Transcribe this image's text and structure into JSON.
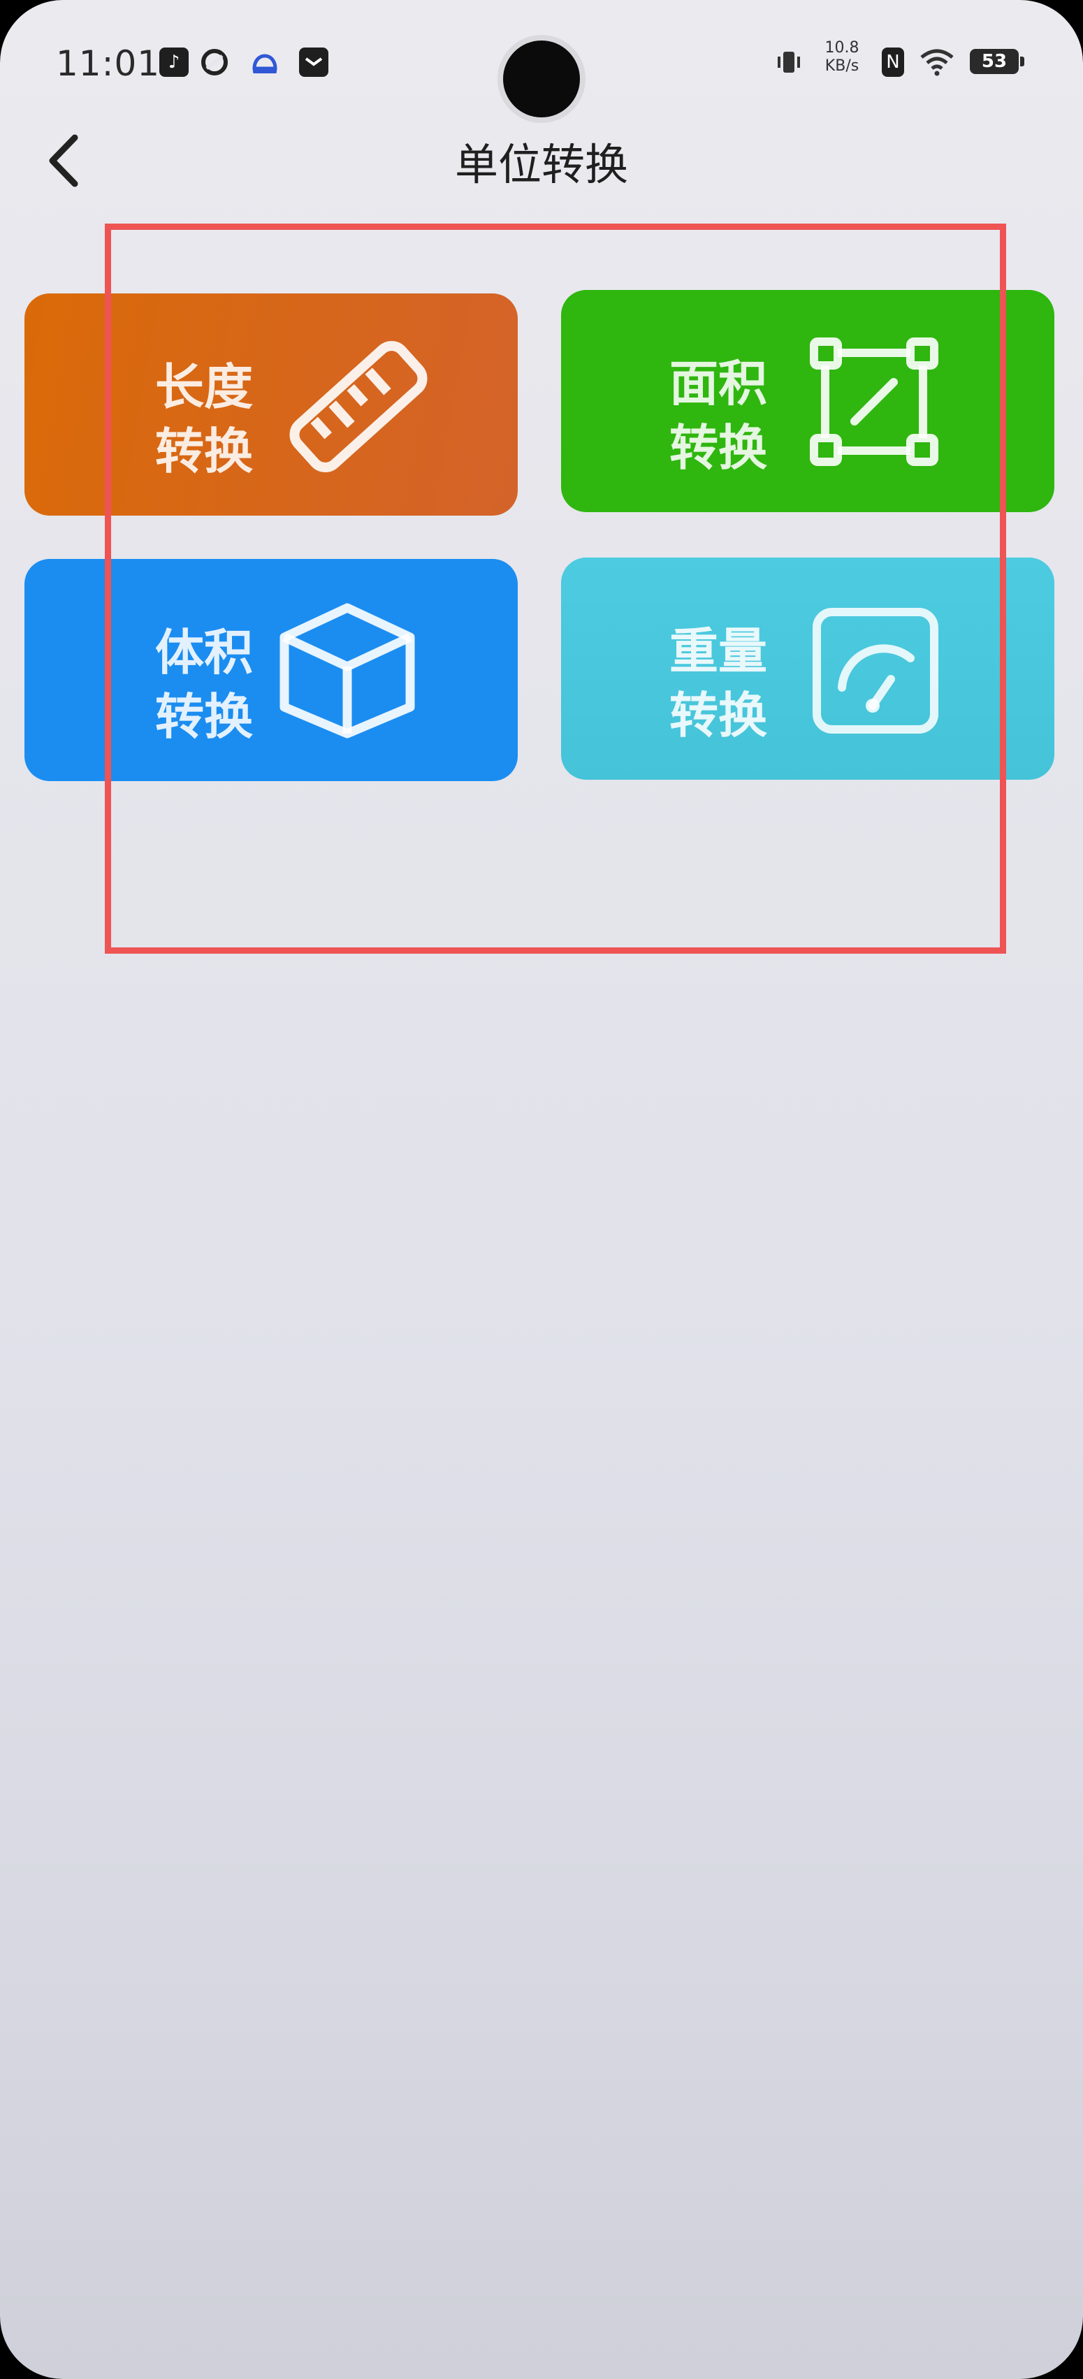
{
  "status_bar": {
    "time": "11:01",
    "net_speed_value": "10.8",
    "net_speed_unit": "KB/s",
    "battery_level": "53",
    "icons": [
      "tiktok-icon",
      "app-icon",
      "cloud-icon",
      "message-icon",
      "vibrate-icon",
      "nfc-icon",
      "wifi-icon"
    ]
  },
  "header": {
    "title": "单位转换",
    "back_icon": "chevron-left-icon"
  },
  "cards": [
    {
      "line1": "长度",
      "line2": "转换",
      "icon": "ruler-icon",
      "color": "#d9690c"
    },
    {
      "line1": "面积",
      "line2": "转换",
      "icon": "area-icon",
      "color": "#2db50f"
    },
    {
      "line1": "体积",
      "line2": "转换",
      "icon": "cube-icon",
      "color": "#1b8df0"
    },
    {
      "line1": "重量",
      "line2": "转换",
      "icon": "gauge-icon",
      "color": "#48c6dd"
    }
  ],
  "highlight_color": "#ee5454"
}
